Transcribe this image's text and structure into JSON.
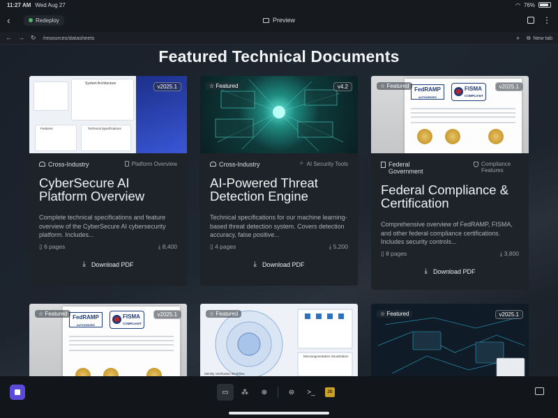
{
  "status": {
    "time": "11:27 AM",
    "date": "Wed Aug 27",
    "battery": "76%"
  },
  "app": {
    "redeploy_label": "Redeploy",
    "preview_label": "Preview"
  },
  "browser": {
    "url": "/resources/datasheets",
    "new_tab_label": "New tab"
  },
  "page": {
    "title": "Featured Technical Documents"
  },
  "cards": [
    {
      "industry": "Cross-Industry",
      "category": "Platform Overview",
      "badge": "",
      "version": "v2025.1",
      "title": "CyberSecure AI Platform Overview",
      "description": "Complete technical specifications and feature overview of the CyberSecure AI cybersecurity platform. Includes...",
      "pages": "6 pages",
      "downloads": "8,400",
      "download_label": "Download PDF",
      "thumb_text": [
        "System Architecture",
        "Features",
        "Technical Specifications"
      ]
    },
    {
      "industry": "Cross-Industry",
      "category": "AI Security Tools",
      "badge": "Featured",
      "version": "v4.2",
      "title": "AI-Powered Threat Detection Engine",
      "description": "Technical specifications for our machine learning-based threat detection system. Covers detection accuracy, false positive...",
      "pages": "4 pages",
      "downloads": "5,200",
      "download_label": "Download PDF"
    },
    {
      "industry": "Federal Government",
      "category": "Compliance Features",
      "badge": "Featured",
      "version": "v2025.1",
      "title": "Federal Compliance & Certification",
      "description": "Comprehensive overview of FedRAMP, FISMA, and other federal compliance certifications. Includes security controls...",
      "pages": "8 pages",
      "downloads": "3,800",
      "download_label": "Download PDF",
      "thumb_text": [
        "FedRAMP",
        "AUTHORIZED",
        "FISMA",
        "COMPLIANT"
      ]
    },
    {
      "badge": "Featured",
      "version": "v2025.1",
      "thumb_text": [
        "FedRAMP",
        "AUTHORIZED",
        "FISMA",
        "COMPLIANT"
      ]
    },
    {
      "badge": "Featured",
      "thumb_text": [
        "Identity Verification Workflow",
        "Microsegmentation Visualization"
      ]
    },
    {
      "badge": "Featured",
      "version": "v2025.1"
    }
  ],
  "dock": {
    "icons": [
      "stop-icon",
      "monitor-icon",
      "grid-icon",
      "globe-icon",
      "database-icon",
      "terminal-icon",
      "js-icon",
      "sidebar-toggle-icon"
    ],
    "js_label": "JS"
  },
  "colors": {
    "accent": "#5b4ad8",
    "background": "#1a2029",
    "card": "#1d2329"
  }
}
